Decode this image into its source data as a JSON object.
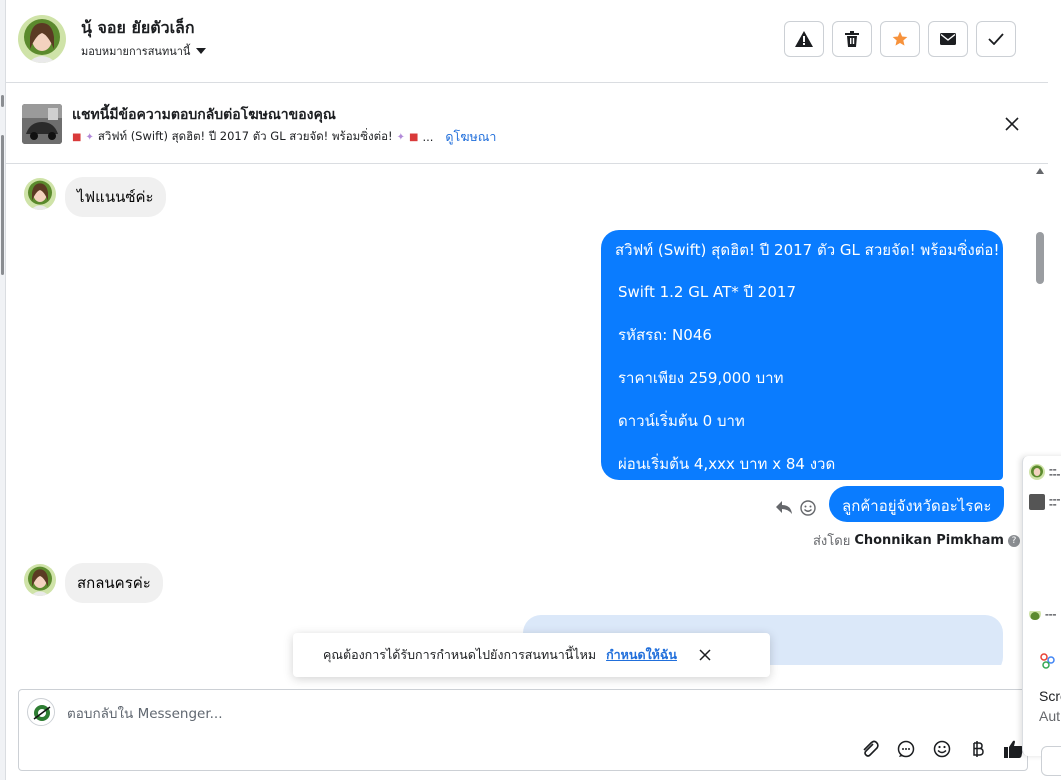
{
  "header": {
    "contact_name": "นุ้ จอย ยัยตัวเล็ก",
    "assign_label": "มอบหมายการสนทนานี้",
    "actions": [
      {
        "name": "report-spam-button",
        "icon": "warning-icon"
      },
      {
        "name": "delete-button",
        "icon": "trash-icon"
      },
      {
        "name": "star-button",
        "icon": "star-icon"
      },
      {
        "name": "mark-unread-button",
        "icon": "envelope-icon"
      },
      {
        "name": "mark-done-button",
        "icon": "check-icon"
      }
    ]
  },
  "ad_banner": {
    "title": "แชทนี้มีข้อความตอบกลับต่อโฆษณาของคุณ",
    "snippet": "สวิฟท์ (Swift) สุดฮิต! ปี 2017 ตัว GL สวยจัด! พร้อมซิ่งต่อ!",
    "ellipsis": "...",
    "link": "ดูโฆษณา"
  },
  "thread": {
    "incoming_1": "ไฟแนนซ์ค่ะ",
    "outgoing_ad": [
      "สวิฟท์ (Swift) สุดฮิต! ปี 2017 ตัว GL สวยจัด! พร้อมซิ่งต่อ!",
      "Swift 1.2 GL AT* ปี 2017",
      "รหัสรถ: N046",
      "ราคาเพียง 259,000 บาท",
      "ดาวน์เริ่มต้น 0 บาท",
      "ผ่อนเริ่มต้น 4,xxx บาท x 84 งวด"
    ],
    "outgoing_2": "ลูกค้าอยู่จังหวัดอะไรคะ",
    "sent_by_prefix": "ส่งโดย",
    "sent_by_name": "Chonnikan Pimkham",
    "help": "?",
    "incoming_2": "สกลนครค่ะ"
  },
  "toast": {
    "text": "คุณต้องการได้รับการกำหนดไปยังการสนทนานี้ไหม",
    "link": "กำหนดให้ฉัน"
  },
  "composer": {
    "placeholder": "ตอบกลับใน Messenger...",
    "tools": [
      "paperclip-icon",
      "chat-bubble-icon",
      "emoji-icon",
      "baht-icon",
      "thumbs-up-icon"
    ]
  },
  "side_panel": {
    "line1": "Scre",
    "line2": "Aut"
  },
  "colors": {
    "outgoing_bubble": "#0a7cff",
    "incoming_bubble": "#f0f0f0",
    "link": "#216fdb",
    "star": "#f7923b"
  }
}
